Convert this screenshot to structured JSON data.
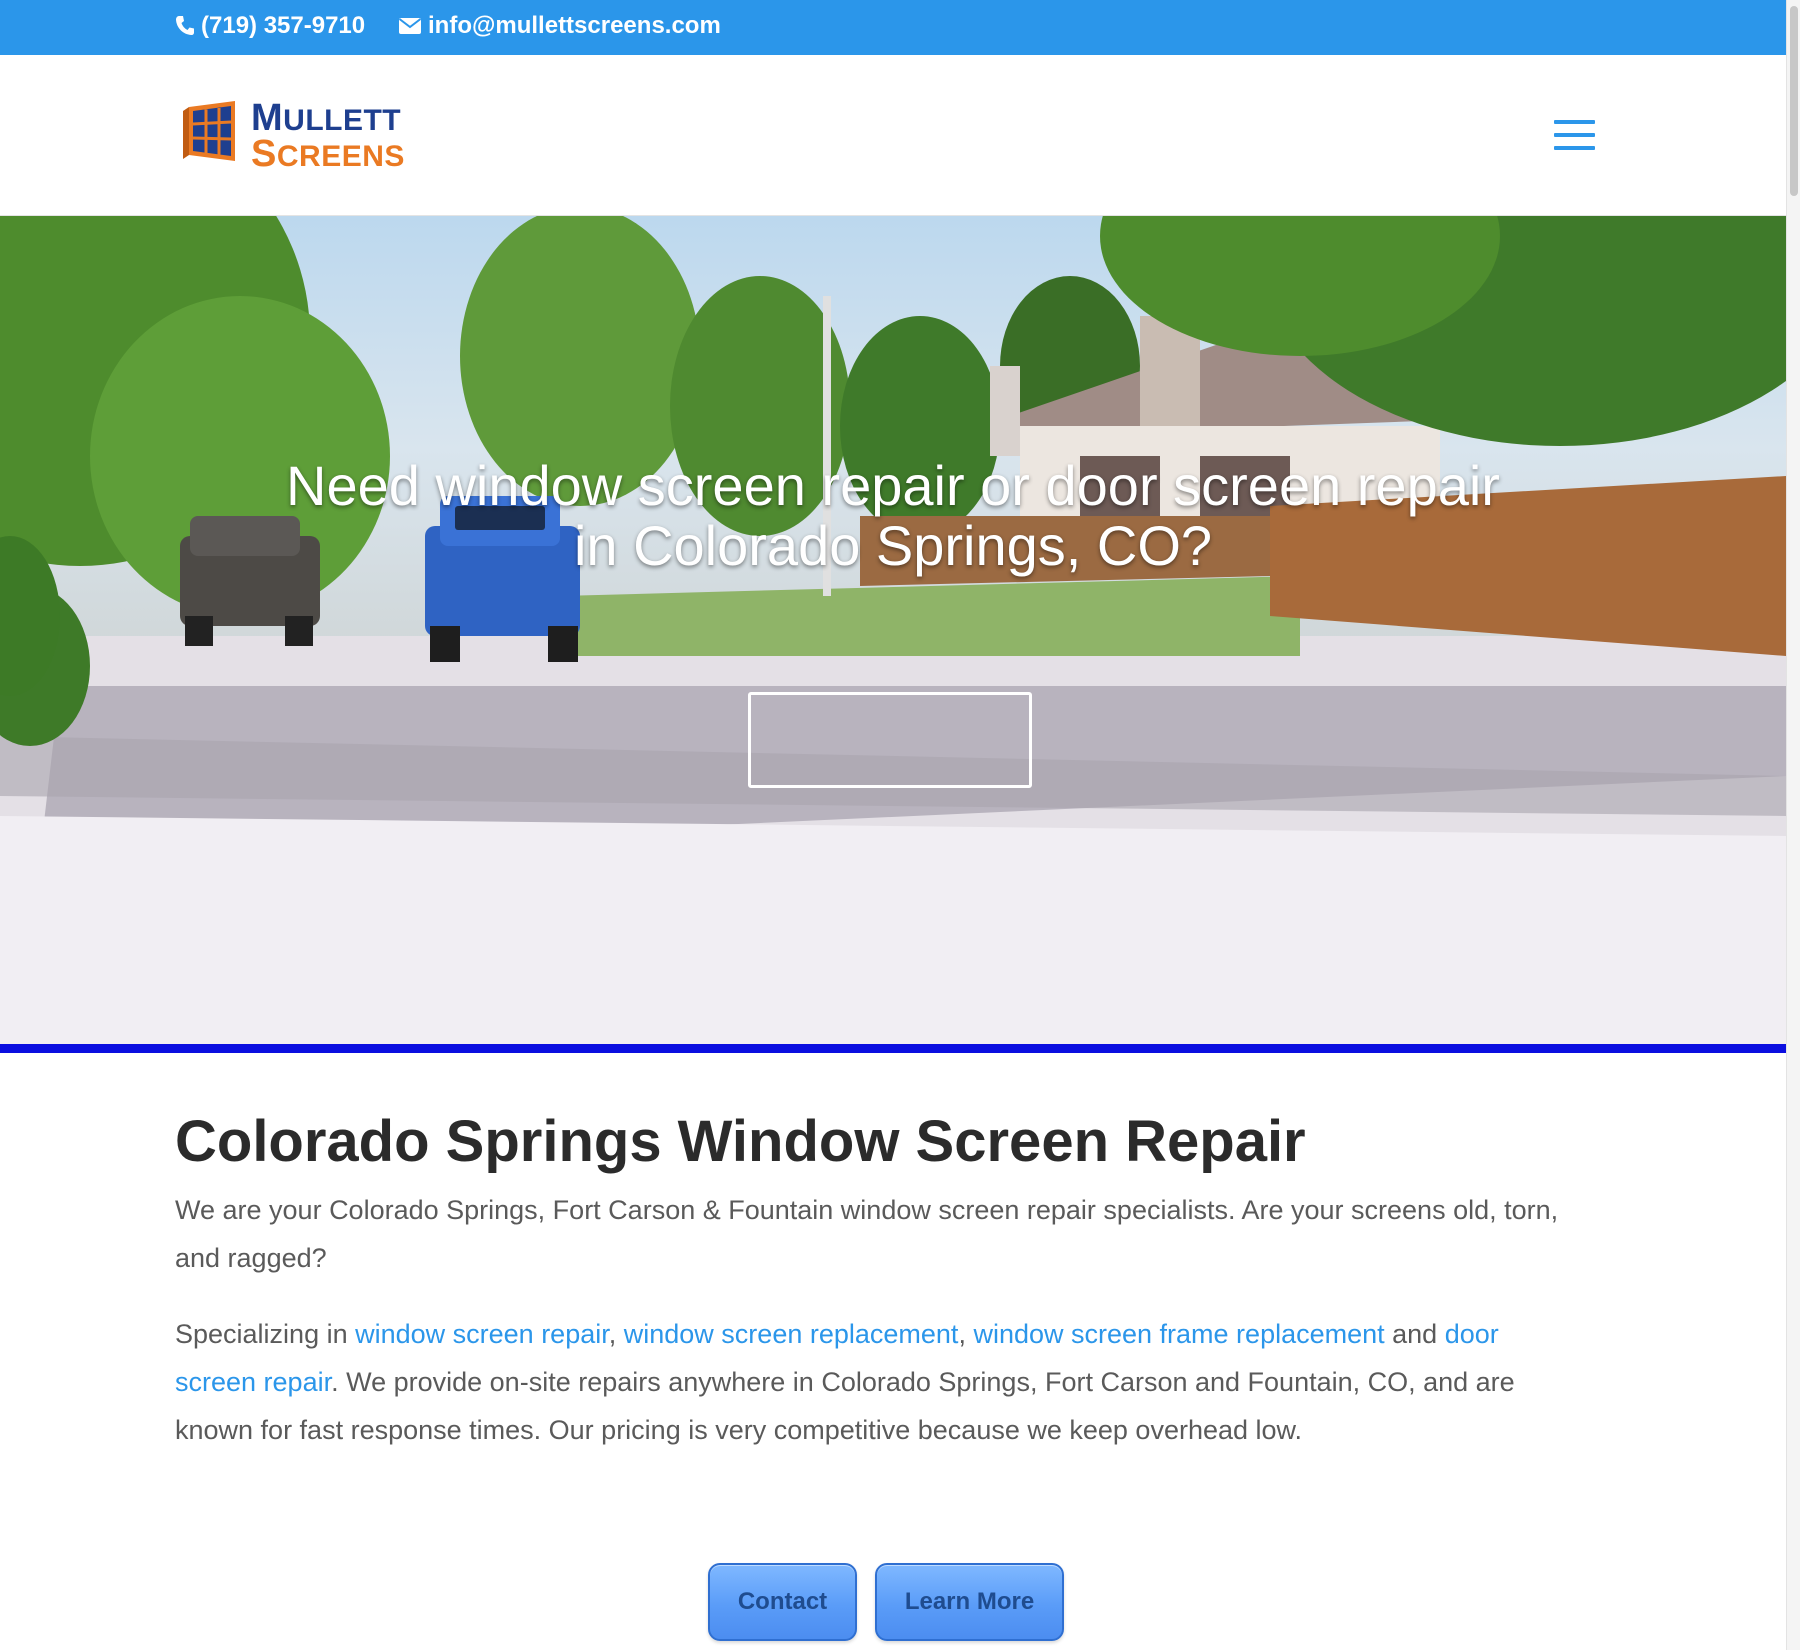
{
  "topbar": {
    "phone": "(719) 357-9710",
    "email": "info@mullettscreens.com",
    "background": "#2b96ea"
  },
  "logo": {
    "line1_first": "M",
    "line1_rest": "ULLETT",
    "line2_first": "S",
    "line2_rest": "CREENS",
    "colors": {
      "mullett": "#1e3f8f",
      "screens": "#ea7a23"
    }
  },
  "hero": {
    "title_line1": "Need window screen repair or door screen repair",
    "title_line2": "in Colorado Springs, CO?",
    "accent_line_color": "#0b0ee0"
  },
  "content": {
    "heading": "Colorado Springs Window Screen Repair",
    "intro": "We are your Colorado Springs, Fort Carson & Fountain window screen repair specialists. Are your screens old, torn, and ragged?",
    "specializing_prefix": "Specializing in ",
    "link1": "window screen repair",
    "sep1": ", ",
    "link2": "window screen replacement",
    "sep2": ", ",
    "link3": "window screen frame replacement",
    "sep3": " and ",
    "link4": "door screen repair",
    "specializing_suffix": ". We provide on-site repairs anywhere in Colorado Springs, Fort Carson and Fountain, CO, and are known for fast response times. Our pricing is very competitive because we keep overhead low.",
    "link_color": "#2b96ea"
  },
  "buttons": {
    "contact": "Contact",
    "learn_more": "Learn More"
  },
  "icons": {
    "phone": "phone-icon",
    "email": "envelope-icon",
    "menu": "hamburger-menu-icon",
    "logo": "window-logo-icon"
  }
}
